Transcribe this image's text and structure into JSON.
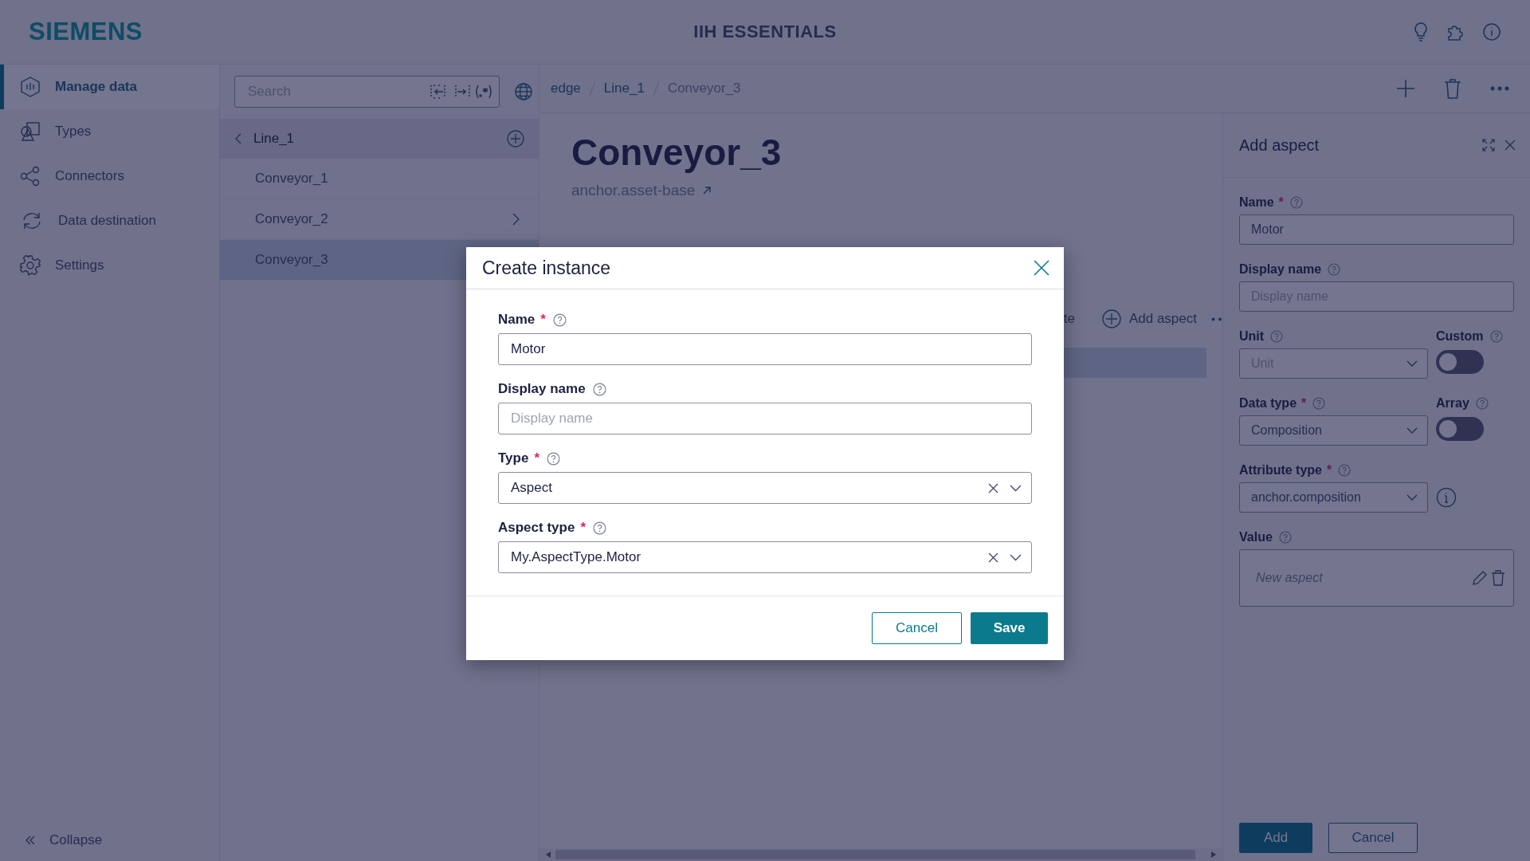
{
  "header": {
    "logo": "SIEMENS",
    "title": "IIH ESSENTIALS"
  },
  "nav": {
    "items": [
      {
        "label": "Manage data",
        "selected": true
      },
      {
        "label": "Types",
        "selected": false
      },
      {
        "label": "Connectors",
        "selected": false
      },
      {
        "label": "Data destination",
        "selected": false
      },
      {
        "label": "Settings",
        "selected": false
      }
    ],
    "collapse": "Collapse"
  },
  "tree": {
    "search_placeholder": "Search",
    "parent": "Line_1",
    "items": [
      {
        "label": "Conveyor_1",
        "selected": false,
        "has_children": false
      },
      {
        "label": "Conveyor_2",
        "selected": false,
        "has_children": true
      },
      {
        "label": "Conveyor_3",
        "selected": true,
        "has_children": false
      }
    ]
  },
  "breadcrumb": [
    "edge",
    "Line_1",
    "Conveyor_3"
  ],
  "asset": {
    "title": "Conveyor_3",
    "type_link": "anchor.asset-base",
    "partial_action": "te",
    "add_aspect": "Add aspect"
  },
  "side_panel": {
    "title": "Add aspect",
    "name": {
      "label": "Name",
      "required_mark": "*",
      "value": "Motor"
    },
    "display_name": {
      "label": "Display name",
      "placeholder": "Display name"
    },
    "unit": {
      "label": "Unit",
      "placeholder": "Unit"
    },
    "custom": {
      "label": "Custom",
      "on": false
    },
    "data_type": {
      "label": "Data type",
      "required_mark": "*",
      "value": "Composition"
    },
    "array": {
      "label": "Array",
      "on": false
    },
    "attribute_type": {
      "label": "Attribute type",
      "required_mark": "*",
      "value": "anchor.composition"
    },
    "value": {
      "label": "Value",
      "text": "New aspect"
    },
    "add": "Add",
    "cancel": "Cancel"
  },
  "dialog": {
    "title": "Create instance",
    "fields": [
      {
        "kind": "text",
        "label": "Name",
        "required_mark": "*",
        "value": "Motor"
      },
      {
        "kind": "text",
        "label": "Display name",
        "placeholder": "Display name"
      },
      {
        "kind": "select",
        "label": "Type",
        "required_mark": "*",
        "value": "Aspect"
      },
      {
        "kind": "select",
        "label": "Aspect type",
        "required_mark": "*",
        "value": "My.AspectType.Motor"
      }
    ],
    "cancel": "Cancel",
    "save": "Save"
  }
}
